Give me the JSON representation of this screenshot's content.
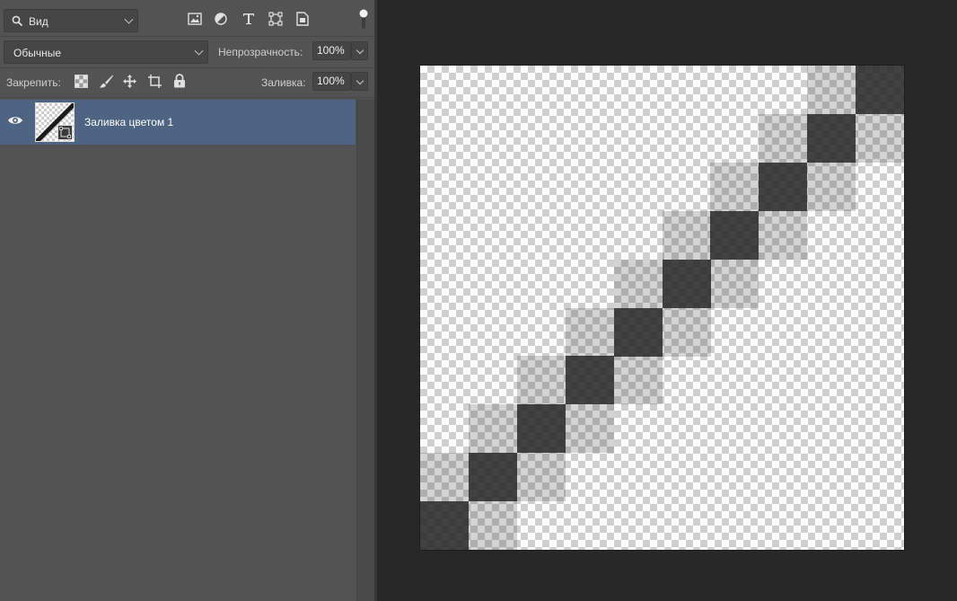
{
  "search": {
    "value": "Вид"
  },
  "filter_icons": [
    "image-filter-icon",
    "adjustment-filter-icon",
    "type-filter-icon",
    "shape-filter-icon",
    "smart-object-filter-icon"
  ],
  "blend": {
    "mode": "Обычные"
  },
  "opacity": {
    "label": "Непрозрачность:",
    "value": "100%"
  },
  "lock": {
    "label": "Закрепить:",
    "icons": [
      "lock-transparent-pixels-icon",
      "lock-image-pixels-icon",
      "lock-position-icon",
      "lock-artboard-icon",
      "lock-all-icon"
    ]
  },
  "fill": {
    "label": "Заливка:",
    "value": "100%"
  },
  "layers": [
    {
      "name": "Заливка цветом 1",
      "visible": true,
      "selected": true
    }
  ],
  "colors": {
    "selection": "#4d6582",
    "panel": "#535353",
    "workspace": "#282828",
    "dark_square": "#3d3d3d"
  },
  "canvas": {
    "pattern": [
      {
        "row": 0,
        "col": 9,
        "tone": "dark"
      },
      {
        "row": 0,
        "col": 8,
        "tone": "light"
      },
      {
        "row": 1,
        "col": 9,
        "tone": "light"
      },
      {
        "row": 1,
        "col": 8,
        "tone": "dark"
      },
      {
        "row": 1,
        "col": 7,
        "tone": "light"
      },
      {
        "row": 2,
        "col": 8,
        "tone": "light"
      },
      {
        "row": 2,
        "col": 7,
        "tone": "dark"
      },
      {
        "row": 2,
        "col": 6,
        "tone": "light"
      },
      {
        "row": 3,
        "col": 7,
        "tone": "light"
      },
      {
        "row": 3,
        "col": 6,
        "tone": "dark"
      },
      {
        "row": 3,
        "col": 5,
        "tone": "light"
      },
      {
        "row": 4,
        "col": 6,
        "tone": "light"
      },
      {
        "row": 4,
        "col": 5,
        "tone": "dark"
      },
      {
        "row": 4,
        "col": 4,
        "tone": "light"
      },
      {
        "row": 5,
        "col": 5,
        "tone": "light"
      },
      {
        "row": 5,
        "col": 4,
        "tone": "dark"
      },
      {
        "row": 5,
        "col": 3,
        "tone": "light"
      },
      {
        "row": 6,
        "col": 4,
        "tone": "light"
      },
      {
        "row": 6,
        "col": 3,
        "tone": "dark"
      },
      {
        "row": 6,
        "col": 2,
        "tone": "light"
      },
      {
        "row": 7,
        "col": 3,
        "tone": "light"
      },
      {
        "row": 7,
        "col": 2,
        "tone": "dark"
      },
      {
        "row": 7,
        "col": 1,
        "tone": "light"
      },
      {
        "row": 8,
        "col": 2,
        "tone": "light"
      },
      {
        "row": 8,
        "col": 1,
        "tone": "dark"
      },
      {
        "row": 8,
        "col": 0,
        "tone": "light"
      },
      {
        "row": 9,
        "col": 1,
        "tone": "light"
      },
      {
        "row": 9,
        "col": 0,
        "tone": "dark"
      }
    ]
  }
}
